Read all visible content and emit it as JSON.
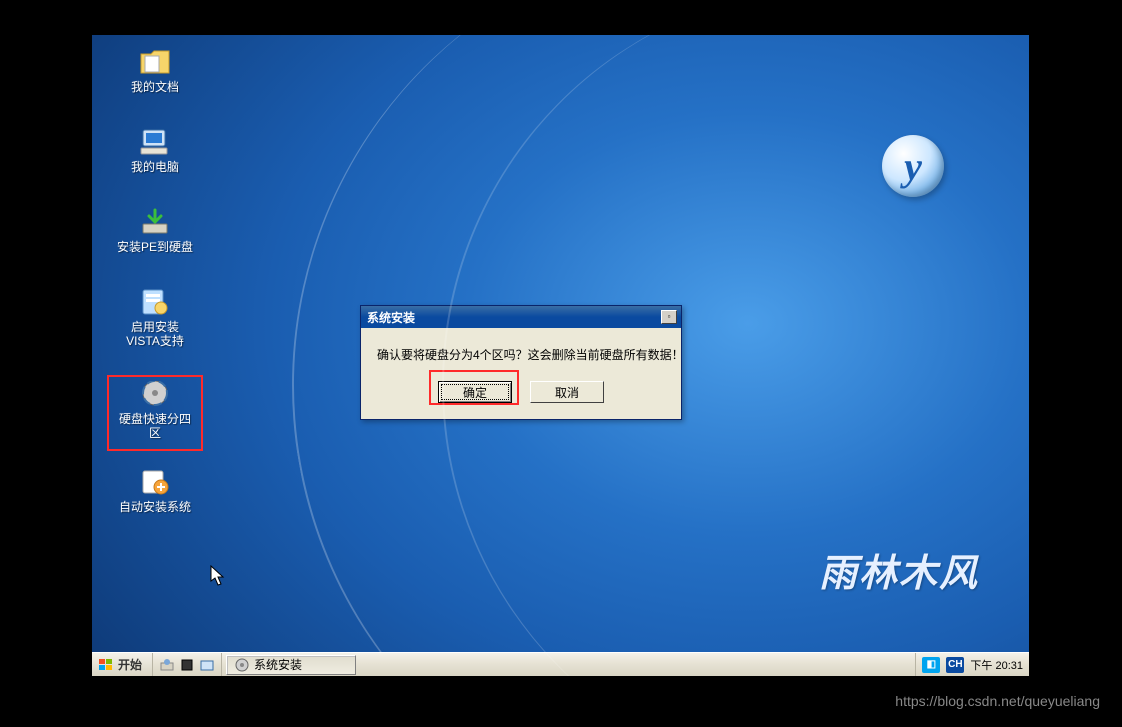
{
  "desktop": {
    "icons": [
      {
        "label": "我的文档"
      },
      {
        "label": "我的电脑"
      },
      {
        "label": "安装PE到硬盘"
      },
      {
        "label": "启用安装\nVISTA支持"
      },
      {
        "label": "硬盘快速分四\n区"
      },
      {
        "label": "自动安装系统"
      }
    ]
  },
  "brand": {
    "logo_letter": "y",
    "text": "雨林木风"
  },
  "dialog": {
    "title": "系统安装",
    "message": "确认要将硬盘分为4个区吗？这会删除当前硬盘所有数据！",
    "ok": "确定",
    "cancel": "取消"
  },
  "taskbar": {
    "start": "开始",
    "task_app": "系统安装",
    "ime1": "CH",
    "ime2": "▫",
    "time_prefix": "下午",
    "time": "20:31"
  },
  "watermark": "https://blog.csdn.net/queyueliang"
}
